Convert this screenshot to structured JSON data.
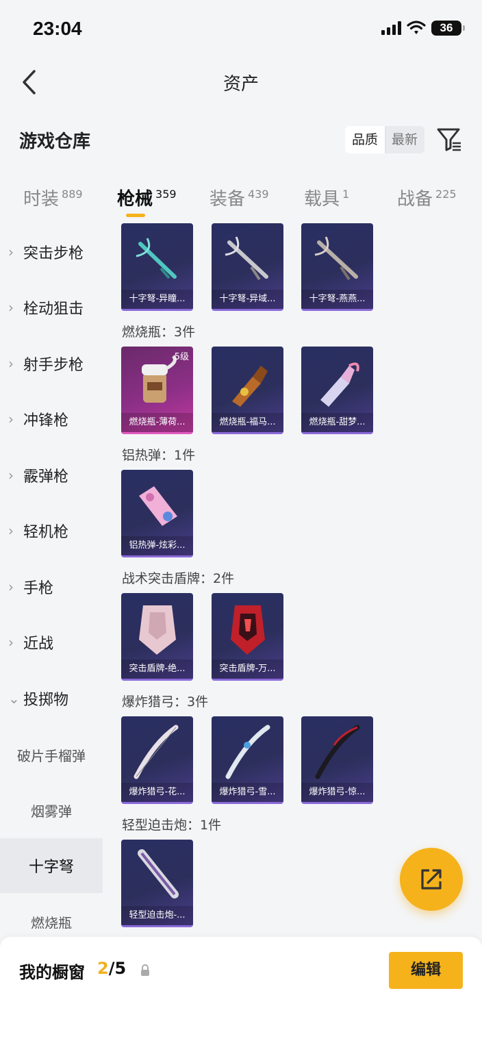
{
  "status": {
    "time": "23:04",
    "battery": "36"
  },
  "nav": {
    "title": "资产"
  },
  "header": {
    "title": "游戏仓库",
    "sort_quality": "品质",
    "sort_newest": "最新"
  },
  "tabs": [
    {
      "label": "时装",
      "count": "889"
    },
    {
      "label": "枪械",
      "count": "359"
    },
    {
      "label": "装备",
      "count": "439"
    },
    {
      "label": "载具",
      "count": "1"
    },
    {
      "label": "战备",
      "count": "225"
    }
  ],
  "sidebar": {
    "items": [
      "突击步枪",
      "栓动狙击",
      "射手步枪",
      "冲锋枪",
      "霰弹枪",
      "轻机枪",
      "手枪",
      "近战",
      "投掷物"
    ],
    "subitems": [
      "破片手榴弹",
      "烟雾弹",
      "十字弩",
      "燃烧瓶"
    ]
  },
  "groups": [
    {
      "title": "",
      "cards": [
        "十字弩-异瞳...",
        "十字弩-异域...",
        "十字弩-燕燕..."
      ]
    },
    {
      "title": "燃烧瓶：3件",
      "cards": [
        "燃烧瓶-薄荷...",
        "燃烧瓶-福马...",
        "燃烧瓶-甜梦..."
      ],
      "level": "5级"
    },
    {
      "title": "铝热弹：1件",
      "cards": [
        "铝热弹-炫彩..."
      ]
    },
    {
      "title": "战术突击盾牌：2件",
      "cards": [
        "突击盾牌-绝...",
        "突击盾牌-万..."
      ]
    },
    {
      "title": "爆炸猎弓：3件",
      "cards": [
        "爆炸猎弓-花...",
        "爆炸猎弓-雪...",
        "爆炸猎弓-惊..."
      ]
    },
    {
      "title": "轻型迫击炮：1件",
      "cards": [
        "轻型迫击炮-..."
      ]
    }
  ],
  "bottom": {
    "label": "我的橱窗",
    "current": "2",
    "total": "/5",
    "edit": "编辑"
  },
  "colors": {
    "accent": "#f5b21b",
    "card_bg": "#2c2f5c",
    "card_pink": "#8c2f86"
  },
  "icons": [
    "back-icon",
    "filter-icon",
    "lock-icon",
    "share-icon",
    "chevron-right-icon",
    "chevron-down-icon"
  ]
}
